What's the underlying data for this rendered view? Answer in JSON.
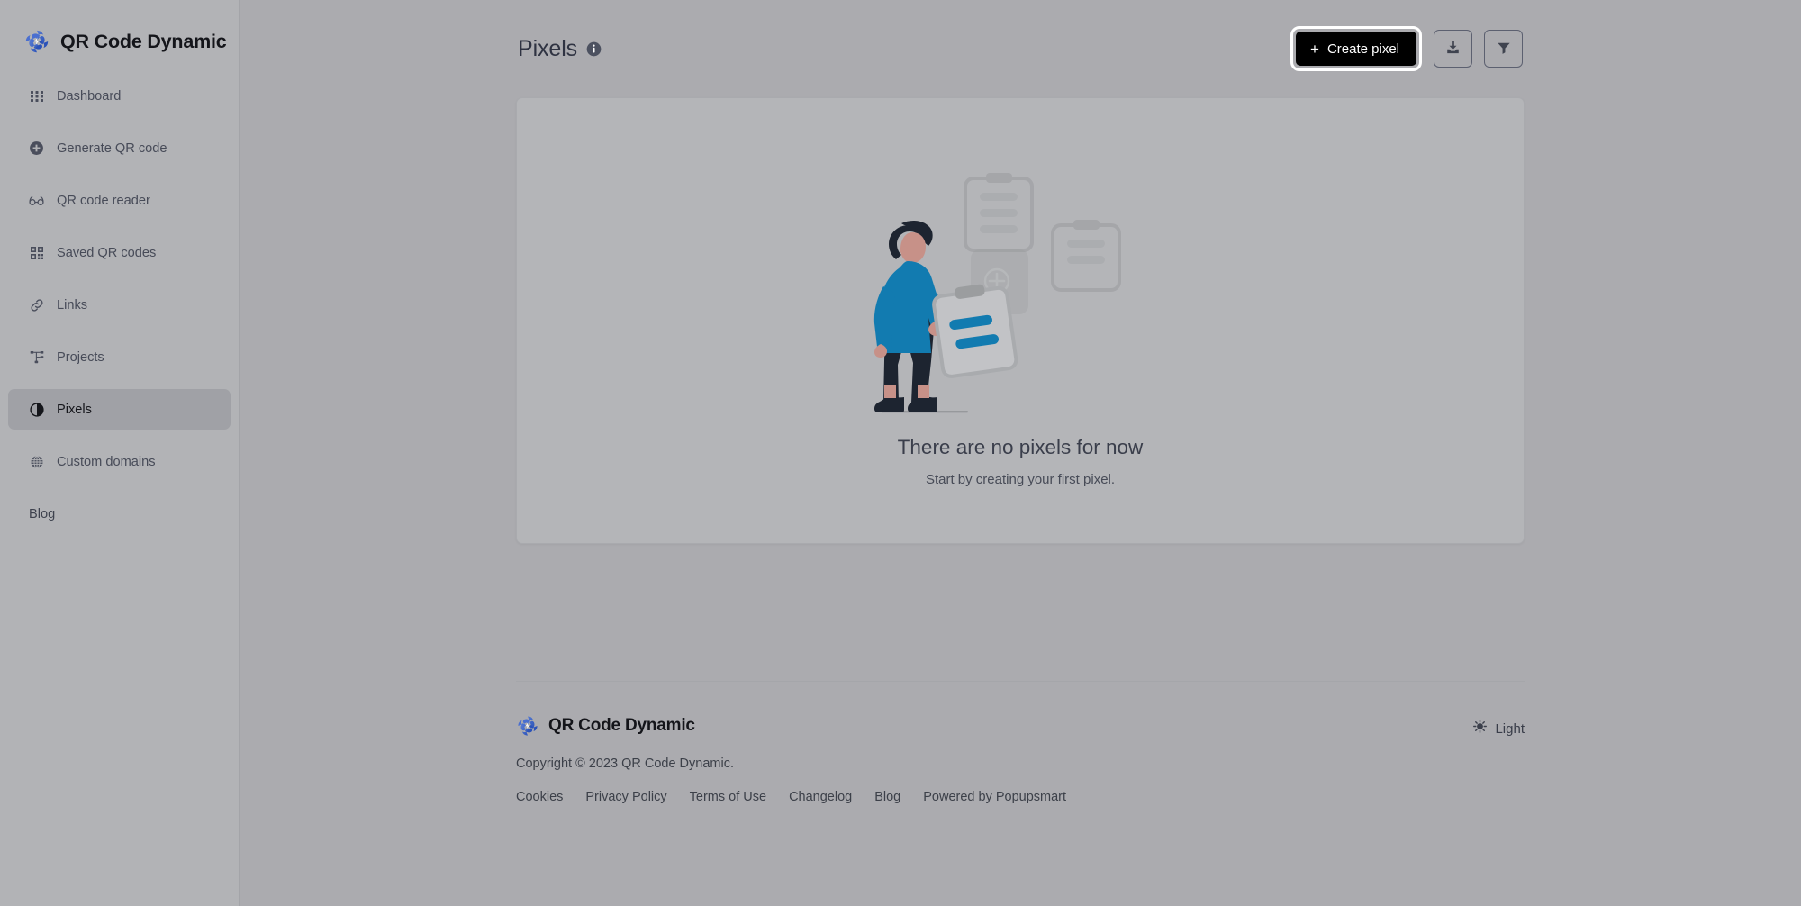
{
  "brand": {
    "name": "QR Code Dynamic",
    "logo_icon": "qr-code-dynamic-logo"
  },
  "sidebar": {
    "items": [
      {
        "label": "Dashboard",
        "icon": "grid-icon",
        "active": false
      },
      {
        "label": "Generate QR code",
        "icon": "plus-circle-icon",
        "active": false
      },
      {
        "label": "QR code reader",
        "icon": "glasses-icon",
        "active": false
      },
      {
        "label": "Saved QR codes",
        "icon": "qr-squares-icon",
        "active": false
      },
      {
        "label": "Links",
        "icon": "link-icon",
        "active": false
      },
      {
        "label": "Projects",
        "icon": "sitemap-icon",
        "active": false
      },
      {
        "label": "Pixels",
        "icon": "contrast-icon",
        "active": true
      },
      {
        "label": "Custom domains",
        "icon": "globe-icon",
        "active": false
      },
      {
        "label": "Blog",
        "icon": "",
        "active": false
      }
    ]
  },
  "header": {
    "title": "Pixels",
    "info_icon": "info-icon",
    "create_button": {
      "label": "Create pixel",
      "plus_glyph": "+",
      "focused": true,
      "background": "#000000",
      "text_color": "#ffffff"
    },
    "download_button": {
      "icon": "download-icon",
      "label": ""
    },
    "filter_button": {
      "icon": "filter-icon",
      "label": ""
    }
  },
  "empty_state": {
    "illustration": "person-with-clipboards-illustration",
    "title": "There are no pixels for now",
    "subtitle": "Start by creating your first pixel."
  },
  "footer": {
    "brand_name": "QR Code Dynamic",
    "logo_icon": "qr-code-dynamic-logo",
    "copyright": "Copyright © 2023 QR Code Dynamic.",
    "links": [
      {
        "label": "Cookies"
      },
      {
        "label": "Privacy Policy"
      },
      {
        "label": "Terms of Use"
      },
      {
        "label": "Changelog"
      },
      {
        "label": "Blog"
      },
      {
        "label": "Powered by Popupsmart"
      }
    ],
    "theme": {
      "label": "Light",
      "icon": "sun-icon"
    }
  },
  "colors": {
    "page_background": "#ababaf",
    "sidebar_background": "#b2b3b6",
    "card_background": "#b4b5b8",
    "accent_blue": "#1f7fb5",
    "text_primary": "#2f3342",
    "text_muted": "#474b58"
  }
}
